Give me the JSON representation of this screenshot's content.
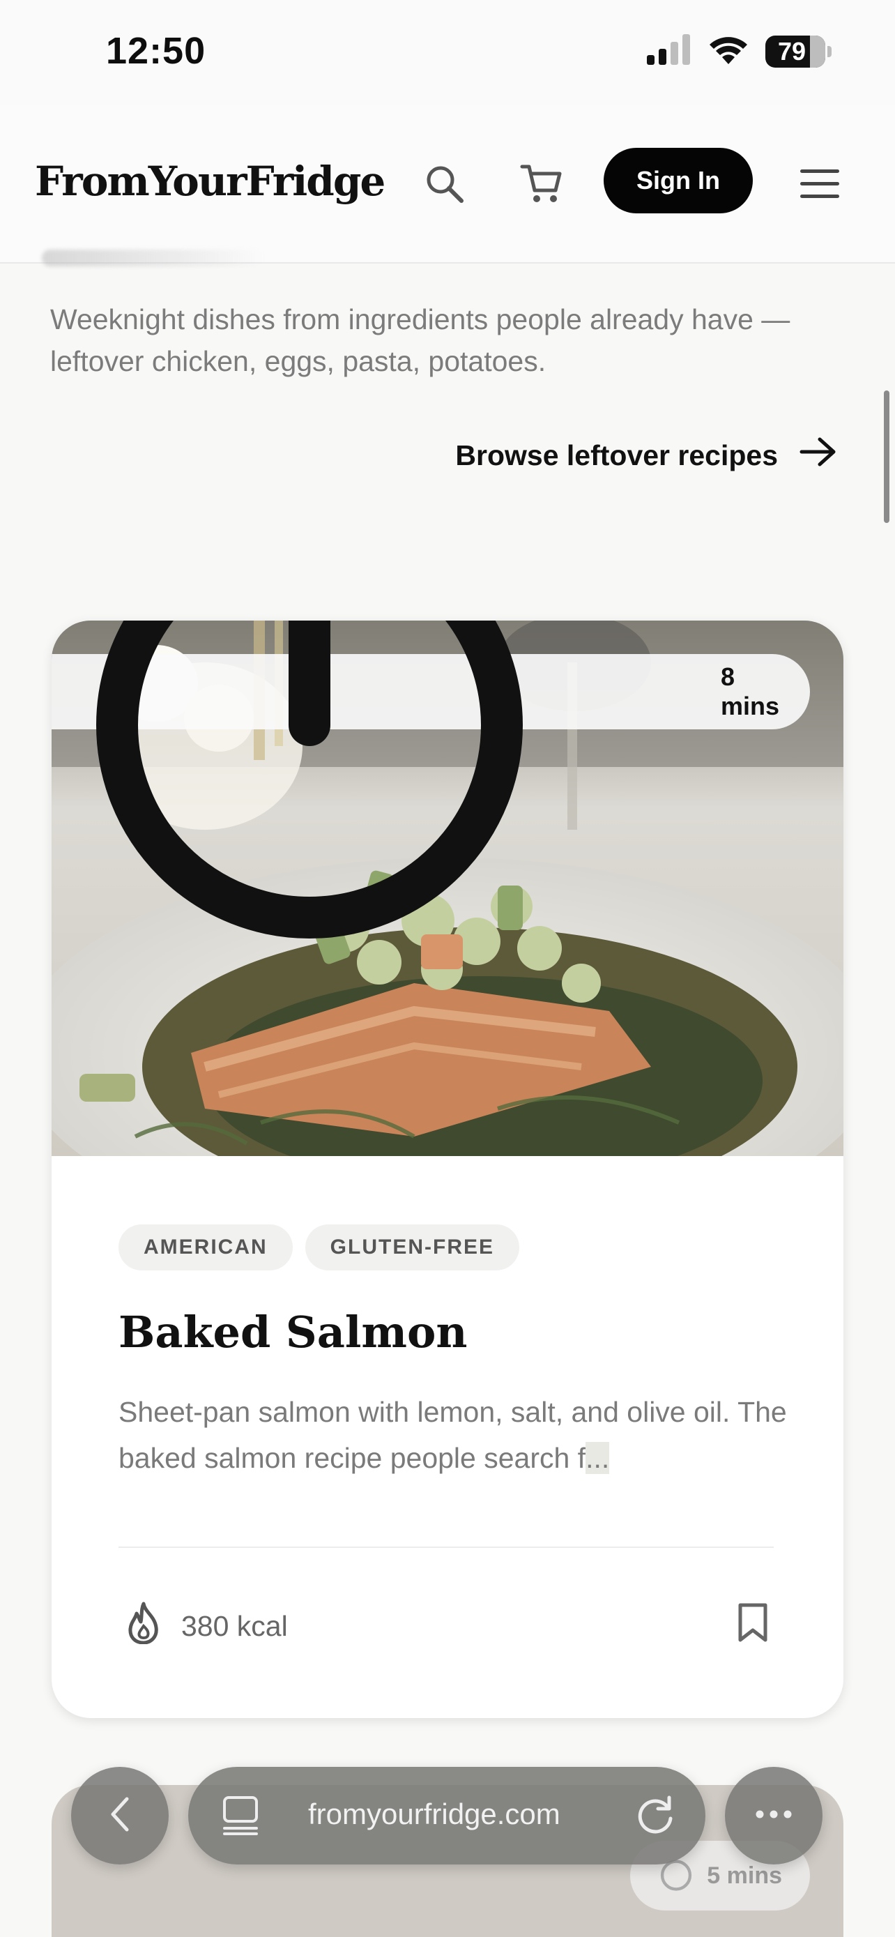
{
  "status_bar": {
    "time": "12:50",
    "battery": "79",
    "icons": [
      "signal-icon",
      "wifi-icon",
      "battery-icon"
    ]
  },
  "header": {
    "logo": "FromYourFridge",
    "sign_in_label": "Sign In",
    "icons": [
      "search-icon",
      "cart-icon",
      "menu-icon"
    ]
  },
  "intro": {
    "text": "Weeknight dishes from ingredients people already have — leftover chicken, eggs, pasta, potatoes.",
    "browse_link": "Browse leftover recipes"
  },
  "recipe_card": {
    "time": "8 mins",
    "tags": [
      "AMERICAN",
      "GLUTEN-FREE"
    ],
    "title": "Baked Salmon",
    "description": "Sheet-pan salmon with lemon, salt, and olive oil. The baked salmon recipe people search f",
    "ellipsis": "...",
    "calories": "380 kcal",
    "icons": [
      "timer-icon",
      "flame-icon",
      "bookmark-icon"
    ]
  },
  "next_card": {
    "time": "5 mins"
  },
  "browser": {
    "url": "fromyourfridge.com",
    "icons": [
      "back-icon",
      "tabs-icon",
      "reload-icon",
      "more-icon"
    ]
  },
  "colors": {
    "accent": "#050505",
    "muted_text": "#7a7a7a",
    "tag_bg": "#f1f1f0"
  }
}
